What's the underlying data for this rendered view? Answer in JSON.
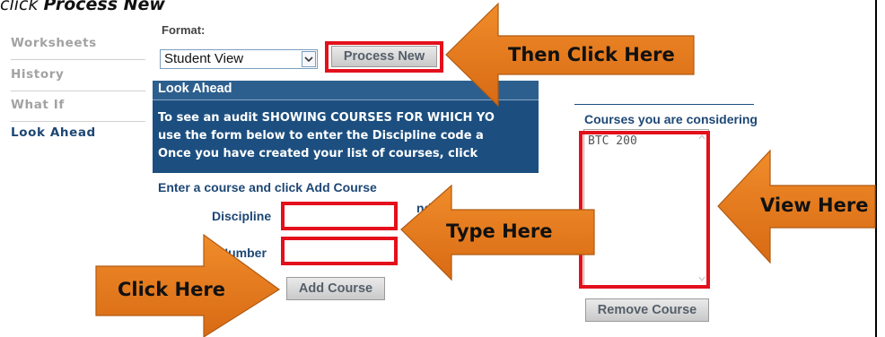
{
  "caption": {
    "prefix": "click ",
    "emphasis": "Process New"
  },
  "sidebar": {
    "items": [
      {
        "label": "Worksheets"
      },
      {
        "label": "History"
      },
      {
        "label": "What If"
      },
      {
        "label": "Look Ahead",
        "active": true
      }
    ]
  },
  "format": {
    "label": "Format:",
    "selected": "Student View",
    "process_button": "Process New"
  },
  "look_ahead": {
    "title": "Look Ahead",
    "lines": [
      "To see an audit SHOWING COURSES FOR WHICH YO",
      "use the form below to enter the Discipline code a",
      "Once you have created your list of courses, click"
    ]
  },
  "course_form": {
    "instruction": "Enter a course and click Add Course",
    "partial_text": "nd",
    "discipline_label": "Discipline",
    "number_label": "Number",
    "discipline_value": "",
    "number_value": "",
    "add_button": "Add Course"
  },
  "courses_panel": {
    "title": "Courses you are considering",
    "items": [
      "BTC 200"
    ],
    "remove_button": "Remove Course"
  },
  "callouts": {
    "then_click": "Then Click Here",
    "view": "View Here",
    "type": "Type Here",
    "click": "Click Here"
  },
  "colors": {
    "arrow_fill": "#e07a1e",
    "highlight": "#e3101b",
    "header_blue": "#1c4f80",
    "label_blue": "#1d4775"
  }
}
